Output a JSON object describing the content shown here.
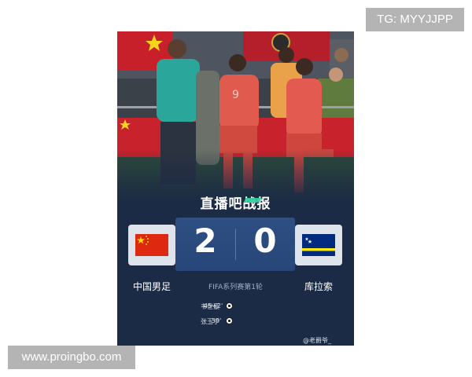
{
  "watermarks": {
    "top": "TG: MYYJJPP",
    "bottom": "www.proingbo.com"
  },
  "poster": {
    "brand": "直播吧战报",
    "home": {
      "team": "中国男足",
      "score": "2",
      "flag": "china-flag-icon"
    },
    "away": {
      "team": "库拉索",
      "score": "0",
      "flag": "curacao-flag-icon"
    },
    "match_info": "FIFA系列赛第1轮",
    "scorers": [
      {
        "name": "韦世豪",
        "minute": "45+2'"
      },
      {
        "name": "张玉宁",
        "minute": "59'"
      }
    ],
    "credit": "@老爵爷_"
  },
  "colors": {
    "poster_bg": "#1b2a45",
    "score_band": "#2e4f83",
    "accent": "#2fd39c",
    "china_red": "#de2910",
    "china_yellow": "#ffde00",
    "curacao_blue": "#002b7f",
    "curacao_yellow": "#f9e814"
  }
}
